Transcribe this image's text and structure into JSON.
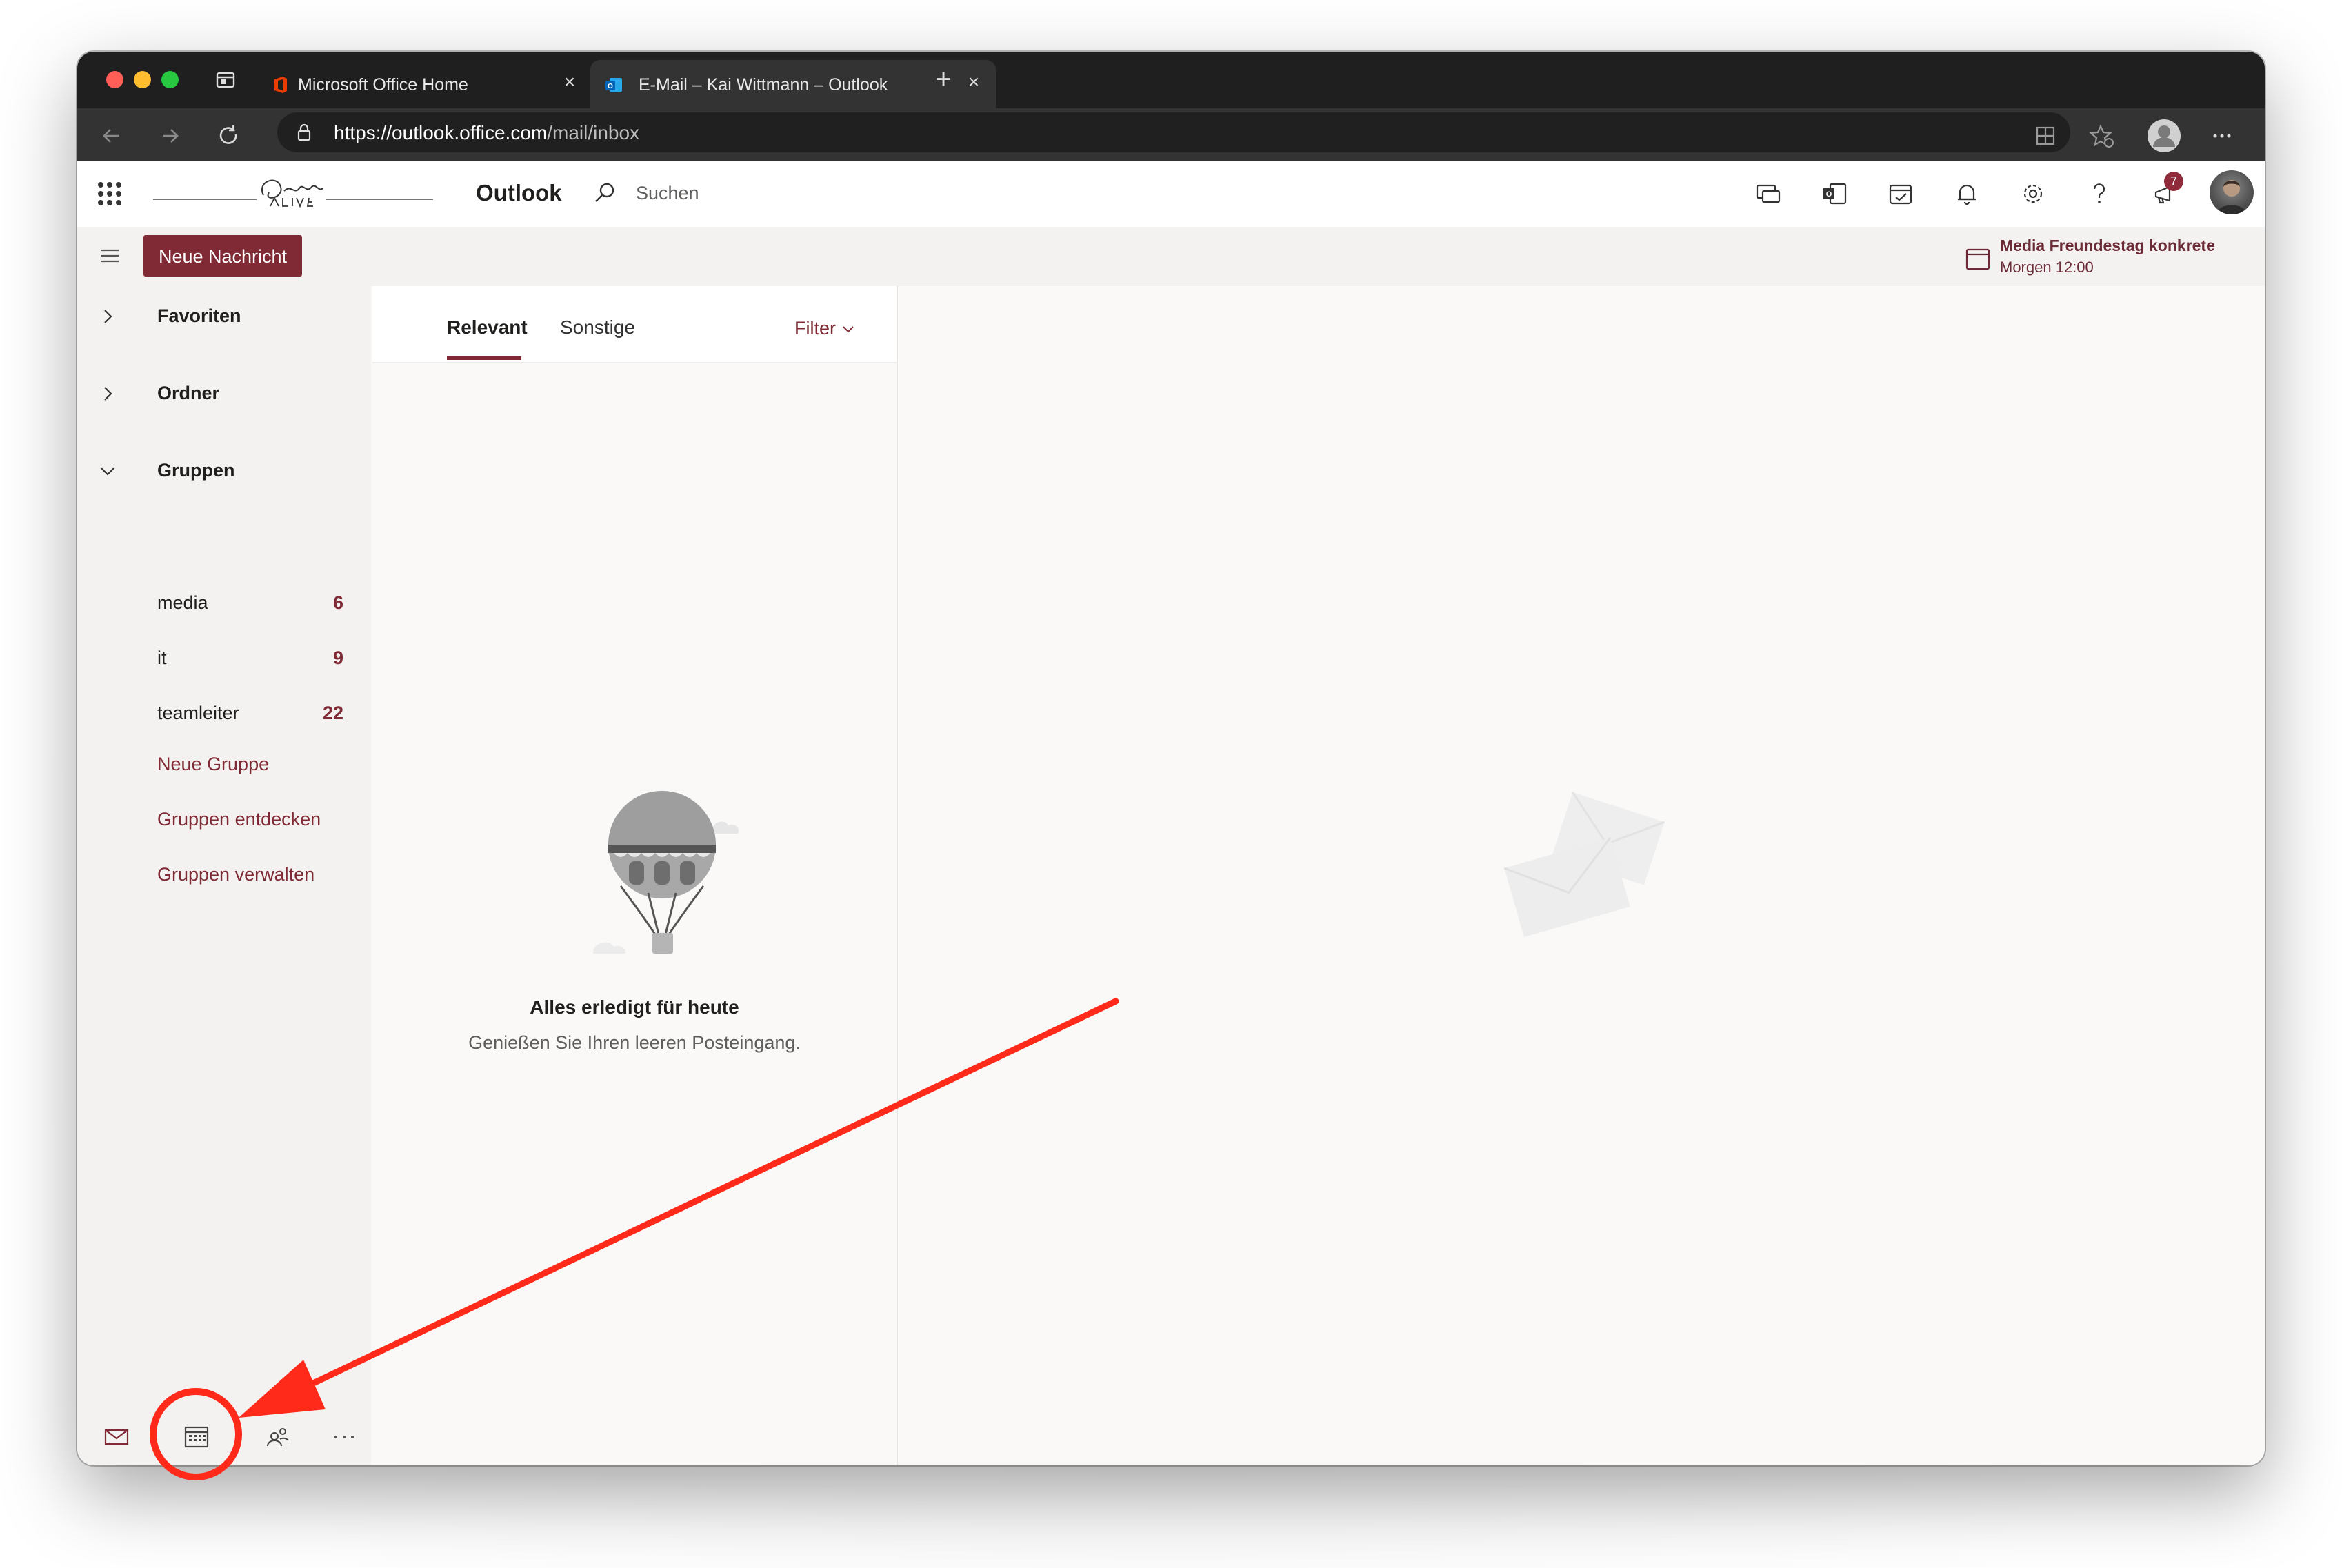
{
  "browser": {
    "tabs": [
      {
        "label": "Microsoft Office Home",
        "favicon": "office-icon"
      },
      {
        "label": "E-Mail – Kai Wittmann – Outlook",
        "favicon": "outlook-icon",
        "active": true
      }
    ],
    "url_scheme": "https://",
    "url_host": "outlook.office.com",
    "url_path": "/mail/inbox"
  },
  "header": {
    "app_name": "Outlook",
    "search_placeholder": "Suchen",
    "notification_count": "7"
  },
  "commandbar": {
    "new_message_label": "Neue Nachricht",
    "reminder": {
      "title": "Media Freundestag konkrete",
      "time": "Morgen 12:00"
    }
  },
  "folders": {
    "sections": [
      {
        "label": "Favoriten",
        "expanded": false
      },
      {
        "label": "Ordner",
        "expanded": false
      },
      {
        "label": "Gruppen",
        "expanded": true
      }
    ],
    "groups": [
      {
        "label": "media",
        "count": "6"
      },
      {
        "label": "it",
        "count": "9"
      },
      {
        "label": "teamleiter",
        "count": "22"
      }
    ],
    "links": [
      "Neue Gruppe",
      "Gruppen entdecken",
      "Gruppen verwalten"
    ]
  },
  "messagelist": {
    "pivots": [
      "Relevant",
      "Sonstige"
    ],
    "filter_label": "Filter",
    "empty_title": "Alles erledigt für heute",
    "empty_subtitle": "Genießen Sie Ihren leeren Posteingang."
  },
  "colors": {
    "accent": "#7f2a35",
    "annotation": "#ff2a1a"
  }
}
